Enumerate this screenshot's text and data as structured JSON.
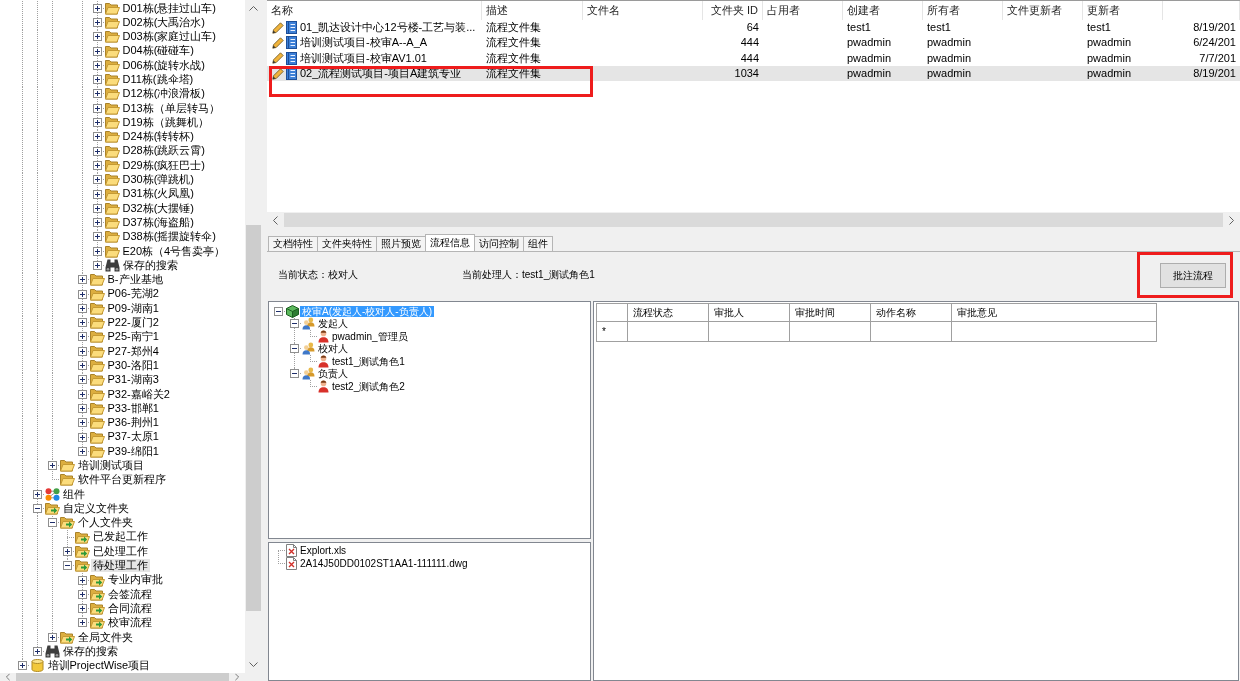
{
  "nav_tree": [
    {
      "children": [
        {
          "children": [
            {
              "children": [
                {
                  "children": [
                    {
                      "children": [
                        {
                          "label": "D01栋(悬挂过山车)",
                          "kind": "folder",
                          "expanded": false,
                          "selected": false
                        },
                        {
                          "label": "D02栋(大禹治水)",
                          "kind": "folder",
                          "expanded": false,
                          "selected": false
                        },
                        {
                          "label": "D03栋(家庭过山车)",
                          "kind": "folder",
                          "expanded": false,
                          "selected": false
                        },
                        {
                          "label": "D04栋(碰碰车)",
                          "kind": "folder",
                          "expanded": false,
                          "selected": false
                        },
                        {
                          "label": "D06栋(旋转水战)",
                          "kind": "folder",
                          "expanded": false,
                          "selected": false
                        },
                        {
                          "label": "D11栋(跳伞塔)",
                          "kind": "folder",
                          "expanded": false,
                          "selected": false
                        },
                        {
                          "label": "D12栋(冲浪滑板)",
                          "kind": "folder",
                          "expanded": false,
                          "selected": false
                        },
                        {
                          "label": "D13栋（单层转马）",
                          "kind": "folder",
                          "expanded": false,
                          "selected": false
                        },
                        {
                          "label": "D19栋（跳舞机）",
                          "kind": "folder",
                          "expanded": false,
                          "selected": false
                        },
                        {
                          "label": "D24栋(转转杯)",
                          "kind": "folder",
                          "expanded": false,
                          "selected": false
                        },
                        {
                          "label": "D28栋(跳跃云霄)",
                          "kind": "folder",
                          "expanded": false,
                          "selected": false
                        },
                        {
                          "label": "D29栋(疯狂巴士)",
                          "kind": "folder",
                          "expanded": false,
                          "selected": false
                        },
                        {
                          "label": "D30栋(弹跳机)",
                          "kind": "folder",
                          "expanded": false,
                          "selected": false
                        },
                        {
                          "label": "D31栋(火凤凰)",
                          "kind": "folder",
                          "expanded": false,
                          "selected": false
                        },
                        {
                          "label": "D32栋(大摆锤)",
                          "kind": "folder",
                          "expanded": false,
                          "selected": false
                        },
                        {
                          "label": "D37栋(海盗船)",
                          "kind": "folder",
                          "expanded": false,
                          "selected": false
                        },
                        {
                          "label": "D38栋(摇摆旋转伞)",
                          "kind": "folder",
                          "expanded": false,
                          "selected": false
                        },
                        {
                          "label": "E20栋（4号售卖亭）",
                          "kind": "folder",
                          "expanded": false,
                          "selected": false
                        },
                        {
                          "label": "保存的搜索",
                          "kind": "search",
                          "expanded": false,
                          "selected": false
                        }
                      ]
                    },
                    {
                      "label": "B-产业基地",
                      "kind": "folder",
                      "expanded": false,
                      "selected": false
                    },
                    {
                      "label": "P06-芜湖2",
                      "kind": "folder",
                      "expanded": false,
                      "selected": false
                    },
                    {
                      "label": "P09-湖南1",
                      "kind": "folder",
                      "expanded": false,
                      "selected": false
                    },
                    {
                      "label": "P22-厦门2",
                      "kind": "folder",
                      "expanded": false,
                      "selected": false
                    },
                    {
                      "label": "P25-南宁1",
                      "kind": "folder",
                      "expanded": false,
                      "selected": false
                    },
                    {
                      "label": "P27-郑州4",
                      "kind": "folder",
                      "expanded": false,
                      "selected": false
                    },
                    {
                      "label": "P30-洛阳1",
                      "kind": "folder",
                      "expanded": false,
                      "selected": false
                    },
                    {
                      "label": "P31-湖南3",
                      "kind": "folder",
                      "expanded": false,
                      "selected": false
                    },
                    {
                      "label": "P32-嘉峪关2",
                      "kind": "folder",
                      "expanded": false,
                      "selected": false
                    },
                    {
                      "label": "P33-邯郸1",
                      "kind": "folder",
                      "expanded": false,
                      "selected": false
                    },
                    {
                      "label": "P36-荆州1",
                      "kind": "folder",
                      "expanded": false,
                      "selected": false
                    },
                    {
                      "label": "P37-太原1",
                      "kind": "folder",
                      "expanded": false,
                      "selected": false
                    },
                    {
                      "label": "P39-绵阳1",
                      "kind": "folder",
                      "expanded": false,
                      "selected": false
                    }
                  ]
                }
              ]
            },
            {
              "label": "培训测试项目",
              "kind": "folder",
              "expanded": false,
              "selected": false
            },
            {
              "label": "软件平台更新程序",
              "kind": "folder",
              "selected": false
            }
          ]
        },
        {
          "label": "组件",
          "kind": "components",
          "expanded": false,
          "selected": false
        },
        {
          "label": "自定义文件夹",
          "kind": "virtual",
          "expanded": true,
          "selected": false,
          "children": [
            {
              "label": "个人文件夹",
              "kind": "virtual",
              "expanded": true,
              "selected": false,
              "children": [
                {
                  "label": "已发起工作",
                  "kind": "virtual",
                  "selected": false
                },
                {
                  "label": "已处理工作",
                  "kind": "virtual",
                  "expanded": false,
                  "selected": false
                },
                {
                  "label": "待处理工作",
                  "kind": "virtual",
                  "expanded": true,
                  "selected": true,
                  "children": [
                    {
                      "label": "专业内审批",
                      "kind": "virtual",
                      "expanded": false,
                      "selected": false
                    },
                    {
                      "label": "会签流程",
                      "kind": "virtual",
                      "expanded": false,
                      "selected": false
                    },
                    {
                      "label": "合同流程",
                      "kind": "virtual",
                      "expanded": false,
                      "selected": false
                    },
                    {
                      "label": "校审流程",
                      "kind": "virtual",
                      "expanded": false,
                      "selected": false
                    }
                  ]
                }
              ]
            },
            {
              "label": "全局文件夹",
              "kind": "virtual",
              "expanded": false,
              "selected": false
            }
          ]
        },
        {
          "label": "保存的搜索",
          "kind": "search",
          "expanded": false,
          "selected": false
        }
      ]
    },
    {
      "label": "培训ProjectWise项目",
      "kind": "project",
      "expanded": false,
      "selected": false
    }
  ],
  "file_list": {
    "columns": [
      {
        "label": "名称",
        "kind": "text"
      },
      {
        "label": "描述",
        "kind": "text"
      },
      {
        "label": "文件名",
        "kind": "text"
      },
      {
        "label": "文件夹 ID",
        "kind": "number"
      },
      {
        "label": "占用者",
        "kind": "text"
      },
      {
        "label": "创建者",
        "kind": "text"
      },
      {
        "label": "所有者",
        "kind": "text"
      },
      {
        "label": "文件更新者",
        "kind": "text"
      },
      {
        "label": "更新者",
        "kind": "text"
      },
      {
        "kind": "number"
      }
    ],
    "rows": [
      {
        "selected": false,
        "highlighted": false,
        "cells": [
          "01_凯达设计中心12号楼-工艺与装...",
          "流程文件集",
          null,
          "64",
          null,
          "test1",
          "test1",
          null,
          "test1",
          "8/19/201"
        ]
      },
      {
        "selected": false,
        "highlighted": false,
        "cells": [
          "培训测试项目-校审A--A_A",
          "流程文件集",
          null,
          "444",
          null,
          "pwadmin",
          "pwadmin",
          null,
          "pwadmin",
          "6/24/201"
        ]
      },
      {
        "selected": false,
        "highlighted": false,
        "cells": [
          "培训测试项目-校审AV1.01",
          "流程文件集",
          null,
          "444",
          null,
          "pwadmin",
          "pwadmin",
          null,
          "pwadmin",
          "7/7/201"
        ]
      },
      {
        "selected": true,
        "highlighted": true,
        "cells": [
          "02_流程测试项目-项目A建筑专业",
          "流程文件集",
          null,
          "1034",
          null,
          "pwadmin",
          "pwadmin",
          null,
          "pwadmin",
          "8/19/201"
        ]
      }
    ]
  },
  "tabs": [
    {
      "label": "文档特性",
      "selected": false
    },
    {
      "label": "文件夹特性",
      "selected": false
    },
    {
      "label": "照片预览",
      "selected": false
    },
    {
      "label": "流程信息",
      "selected": true
    },
    {
      "label": "访问控制",
      "selected": false
    },
    {
      "label": "组件",
      "selected": false
    }
  ],
  "workflow": {
    "current_status": "当前状态：校对人",
    "current_handler": "当前处理人：test1_测试角色1",
    "action_button": {
      "label": "批注流程",
      "highlighted": true
    },
    "tree": [
      {
        "label": "校审A(发起人-校对人-负责人)",
        "kind": "workflow",
        "expanded": true,
        "selected": true,
        "children": [
          {
            "label": "发起人",
            "kind": "role",
            "expanded": true,
            "selected": false,
            "children": [
              {
                "label": "pwadmin_管理员",
                "kind": "user",
                "selected": false
              }
            ]
          },
          {
            "label": "校对人",
            "kind": "role",
            "expanded": true,
            "selected": false,
            "children": [
              {
                "label": "test1_测试角色1",
                "kind": "user",
                "selected": false
              }
            ]
          },
          {
            "label": "负责人",
            "kind": "role",
            "expanded": true,
            "selected": false,
            "children": [
              {
                "label": "test2_测试角色2",
                "kind": "user",
                "selected": false
              }
            ]
          }
        ]
      }
    ],
    "files": [
      {
        "label": "Explort.xls",
        "kind": "file",
        "selected": false
      },
      {
        "label": "2A14J50DD0102ST1AA1-111111.dwg",
        "kind": "file",
        "selected": false
      }
    ],
    "history_grid": {
      "columns": [
        "流程状态",
        "审批人",
        "审批时间",
        "动作名称",
        "审批意见"
      ],
      "new_row_marker": "*"
    }
  }
}
